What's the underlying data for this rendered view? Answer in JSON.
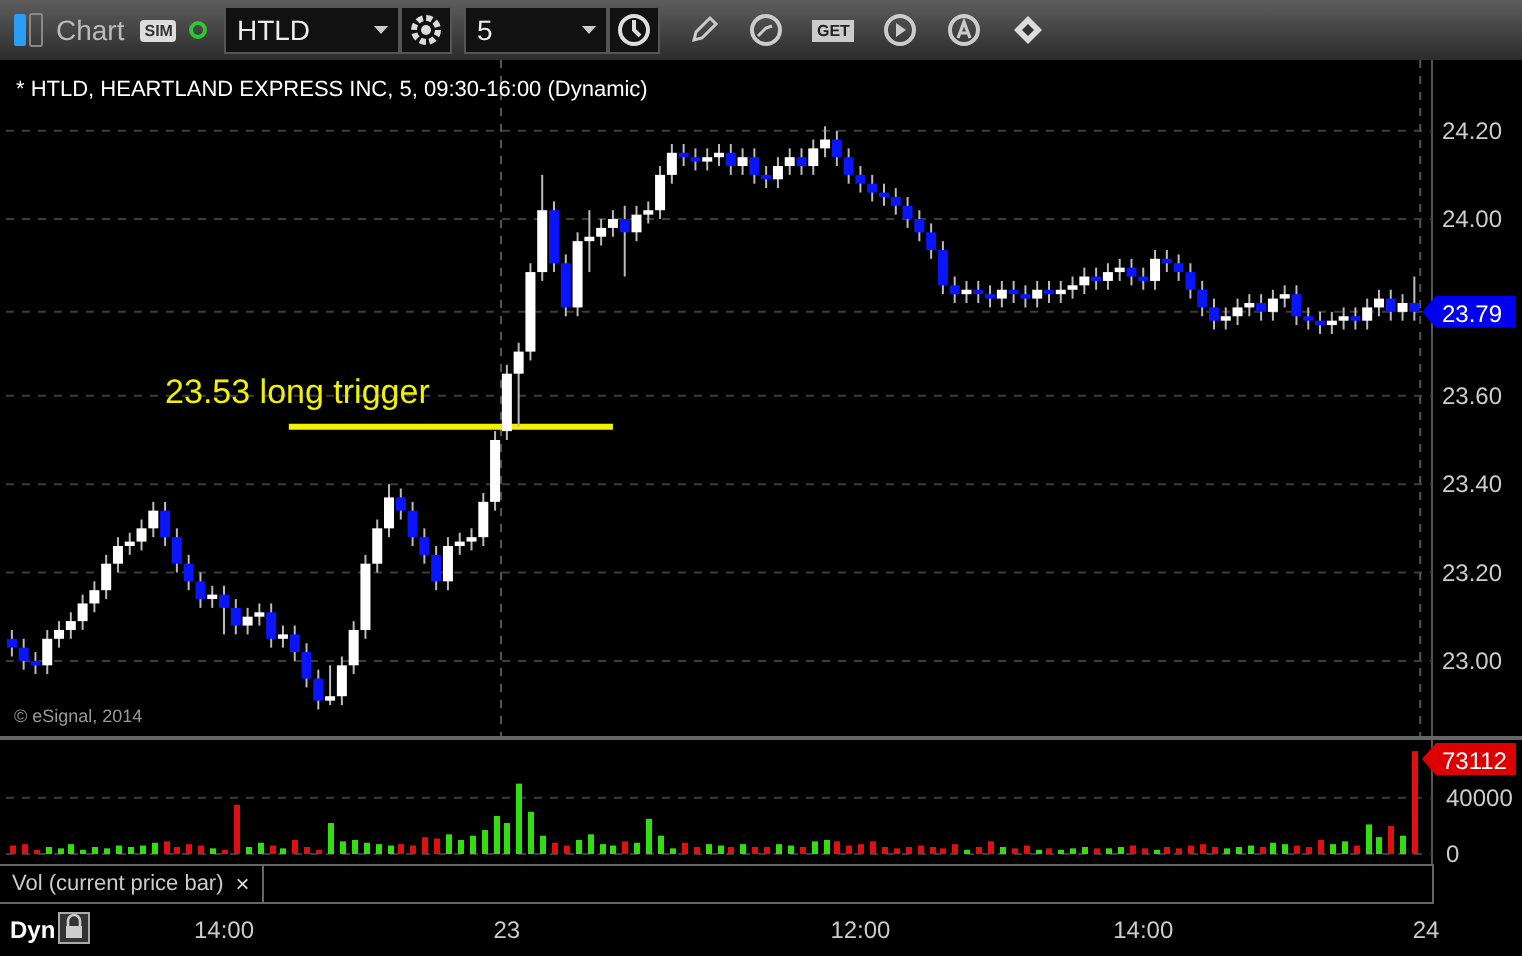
{
  "toolbar": {
    "title": "Chart",
    "badge": "SIM",
    "symbol": "HTLD",
    "interval": "5",
    "get_label": "GET"
  },
  "price_pane": {
    "chart_data": {
      "type": "candlestick",
      "title": "* HTLD, HEARTLAND EXPRESS INC, 5, 09:30-16:00 (Dynamic)",
      "ylim": [
        22.83,
        24.36
      ],
      "grid": true,
      "yticks": [
        {
          "value": 23.0,
          "label": "23.00"
        },
        {
          "value": 23.2,
          "label": "23.20"
        },
        {
          "value": 23.4,
          "label": "23.40"
        },
        {
          "value": 23.6,
          "label": "23.60"
        },
        {
          "value": 24.0,
          "label": "24.00"
        },
        {
          "value": 24.2,
          "label": "24.20"
        }
      ],
      "categories": [
        null,
        null,
        null,
        null,
        null,
        null,
        null,
        null,
        null,
        null,
        null,
        null,
        null,
        null,
        null,
        null,
        null,
        null,
        "14:00",
        null,
        null,
        null,
        null,
        null,
        null,
        null,
        null,
        null,
        null,
        null,
        null,
        null,
        null,
        null,
        null,
        null,
        null,
        null,
        null,
        null,
        null,
        null,
        "23",
        null,
        null,
        null,
        null,
        null,
        null,
        null,
        null,
        null,
        null,
        null,
        null,
        null,
        null,
        null,
        null,
        null,
        null,
        null,
        null,
        null,
        null,
        null,
        null,
        null,
        null,
        null,
        null,
        null,
        "12:00",
        null,
        null,
        null,
        null,
        null,
        null,
        null,
        null,
        null,
        null,
        null,
        null,
        null,
        null,
        null,
        null,
        null,
        null,
        null,
        null,
        null,
        null,
        null,
        "14:00",
        null,
        null,
        null,
        null,
        null,
        null,
        null,
        null,
        null,
        null,
        null,
        null,
        null,
        null,
        null,
        null,
        null,
        null,
        null,
        null,
        null,
        null,
        null,
        "24"
      ],
      "ohlc": [
        [
          23.05,
          23.07,
          23.01,
          23.03
        ],
        [
          23.03,
          23.05,
          22.98,
          23.0
        ],
        [
          23.0,
          23.02,
          22.97,
          22.99
        ],
        [
          22.99,
          23.07,
          22.97,
          23.05
        ],
        [
          23.05,
          23.09,
          23.03,
          23.07
        ],
        [
          23.07,
          23.11,
          23.05,
          23.09
        ],
        [
          23.09,
          23.15,
          23.07,
          23.13
        ],
        [
          23.13,
          23.18,
          23.11,
          23.16
        ],
        [
          23.16,
          23.24,
          23.14,
          23.22
        ],
        [
          23.22,
          23.28,
          23.2,
          23.26
        ],
        [
          23.26,
          23.29,
          23.24,
          23.27
        ],
        [
          23.27,
          23.32,
          23.25,
          23.3
        ],
        [
          23.3,
          23.36,
          23.28,
          23.34
        ],
        [
          23.34,
          23.36,
          23.26,
          23.28
        ],
        [
          23.28,
          23.3,
          23.2,
          23.22
        ],
        [
          23.22,
          23.24,
          23.16,
          23.18
        ],
        [
          23.18,
          23.2,
          23.12,
          23.14
        ],
        [
          23.14,
          23.17,
          23.12,
          23.15
        ],
        [
          23.15,
          23.17,
          23.06,
          23.12
        ],
        [
          23.12,
          23.14,
          23.06,
          23.08
        ],
        [
          23.08,
          23.12,
          23.06,
          23.1
        ],
        [
          23.1,
          23.13,
          23.08,
          23.11
        ],
        [
          23.11,
          23.13,
          23.03,
          23.05
        ],
        [
          23.05,
          23.08,
          23.03,
          23.06
        ],
        [
          23.06,
          23.08,
          23.0,
          23.02
        ],
        [
          23.02,
          23.04,
          22.94,
          22.96
        ],
        [
          22.96,
          22.98,
          22.89,
          22.91
        ],
        [
          22.91,
          22.99,
          22.9,
          22.92
        ],
        [
          22.92,
          23.01,
          22.9,
          22.99
        ],
        [
          22.99,
          23.09,
          22.97,
          23.07
        ],
        [
          23.07,
          23.24,
          23.05,
          23.22
        ],
        [
          23.22,
          23.32,
          23.2,
          23.3
        ],
        [
          23.3,
          23.4,
          23.28,
          23.37
        ],
        [
          23.37,
          23.39,
          23.32,
          23.34
        ],
        [
          23.34,
          23.36,
          23.26,
          23.28
        ],
        [
          23.28,
          23.3,
          23.22,
          23.24
        ],
        [
          23.24,
          23.26,
          23.16,
          23.18
        ],
        [
          23.18,
          23.28,
          23.16,
          23.26
        ],
        [
          23.26,
          23.29,
          23.24,
          23.27
        ],
        [
          23.27,
          23.3,
          23.25,
          23.28
        ],
        [
          23.28,
          23.38,
          23.26,
          23.36
        ],
        [
          23.36,
          23.52,
          23.34,
          23.5
        ],
        [
          23.52,
          23.67,
          23.5,
          23.65
        ],
        [
          23.65,
          23.72,
          23.53,
          23.7
        ],
        [
          23.7,
          23.9,
          23.68,
          23.88
        ],
        [
          23.88,
          24.1,
          23.86,
          24.02
        ],
        [
          24.02,
          24.04,
          23.88,
          23.9
        ],
        [
          23.9,
          23.92,
          23.78,
          23.8
        ],
        [
          23.8,
          23.97,
          23.78,
          23.95
        ],
        [
          23.95,
          24.02,
          23.88,
          23.96
        ],
        [
          23.96,
          24.0,
          23.94,
          23.98
        ],
        [
          23.98,
          24.02,
          23.96,
          24.0
        ],
        [
          24.0,
          24.03,
          23.87,
          23.97
        ],
        [
          23.97,
          24.03,
          23.95,
          24.01
        ],
        [
          24.01,
          24.04,
          23.99,
          24.02
        ],
        [
          24.02,
          24.12,
          24.0,
          24.1
        ],
        [
          24.1,
          24.17,
          24.08,
          24.15
        ],
        [
          24.15,
          24.17,
          24.12,
          24.14
        ],
        [
          24.14,
          24.16,
          24.11,
          24.13
        ],
        [
          24.13,
          24.16,
          24.11,
          24.14
        ],
        [
          24.14,
          24.17,
          24.12,
          24.15
        ],
        [
          24.15,
          24.17,
          24.1,
          24.12
        ],
        [
          24.12,
          24.16,
          24.1,
          24.14
        ],
        [
          24.14,
          24.16,
          24.08,
          24.1
        ],
        [
          24.1,
          24.12,
          24.07,
          24.09
        ],
        [
          24.09,
          24.14,
          24.07,
          24.12
        ],
        [
          24.12,
          24.16,
          24.1,
          24.14
        ],
        [
          24.14,
          24.16,
          24.1,
          24.12
        ],
        [
          24.12,
          24.18,
          24.1,
          24.16
        ],
        [
          24.16,
          24.21,
          24.14,
          24.18
        ],
        [
          24.18,
          24.2,
          24.12,
          24.14
        ],
        [
          24.14,
          24.16,
          24.08,
          24.1
        ],
        [
          24.1,
          24.12,
          24.06,
          24.08
        ],
        [
          24.08,
          24.1,
          24.04,
          24.06
        ],
        [
          24.06,
          24.08,
          24.03,
          24.05
        ],
        [
          24.05,
          24.07,
          24.01,
          24.03
        ],
        [
          24.03,
          24.05,
          23.98,
          24.0
        ],
        [
          24.0,
          24.02,
          23.95,
          23.97
        ],
        [
          23.97,
          23.99,
          23.91,
          23.93
        ],
        [
          23.93,
          23.95,
          23.83,
          23.85
        ],
        [
          23.85,
          23.87,
          23.81,
          23.83
        ],
        [
          23.83,
          23.86,
          23.81,
          23.84
        ],
        [
          23.84,
          23.86,
          23.81,
          23.83
        ],
        [
          23.83,
          23.85,
          23.8,
          23.82
        ],
        [
          23.82,
          23.86,
          23.8,
          23.84
        ],
        [
          23.84,
          23.86,
          23.81,
          23.83
        ],
        [
          23.83,
          23.85,
          23.8,
          23.82
        ],
        [
          23.82,
          23.86,
          23.8,
          23.84
        ],
        [
          23.84,
          23.86,
          23.81,
          23.83
        ],
        [
          23.83,
          23.86,
          23.81,
          23.84
        ],
        [
          23.84,
          23.87,
          23.82,
          23.85
        ],
        [
          23.85,
          23.89,
          23.83,
          23.87
        ],
        [
          23.87,
          23.89,
          23.84,
          23.86
        ],
        [
          23.86,
          23.9,
          23.84,
          23.88
        ],
        [
          23.88,
          23.91,
          23.86,
          23.89
        ],
        [
          23.89,
          23.91,
          23.85,
          23.87
        ],
        [
          23.87,
          23.89,
          23.84,
          23.86
        ],
        [
          23.86,
          23.93,
          23.84,
          23.91
        ],
        [
          23.91,
          23.93,
          23.88,
          23.9
        ],
        [
          23.9,
          23.92,
          23.86,
          23.88
        ],
        [
          23.88,
          23.9,
          23.82,
          23.84
        ],
        [
          23.84,
          23.86,
          23.78,
          23.8
        ],
        [
          23.8,
          23.82,
          23.75,
          23.77
        ],
        [
          23.77,
          23.8,
          23.75,
          23.78
        ],
        [
          23.78,
          23.82,
          23.76,
          23.8
        ],
        [
          23.8,
          23.83,
          23.78,
          23.81
        ],
        [
          23.81,
          23.83,
          23.77,
          23.79
        ],
        [
          23.79,
          23.84,
          23.77,
          23.82
        ],
        [
          23.82,
          23.85,
          23.8,
          23.83
        ],
        [
          23.83,
          23.85,
          23.76,
          23.78
        ],
        [
          23.78,
          23.8,
          23.75,
          23.77
        ],
        [
          23.77,
          23.79,
          23.74,
          23.76
        ],
        [
          23.76,
          23.79,
          23.74,
          23.77
        ],
        [
          23.77,
          23.8,
          23.75,
          23.78
        ],
        [
          23.78,
          23.8,
          23.75,
          23.77
        ],
        [
          23.77,
          23.82,
          23.75,
          23.8
        ],
        [
          23.8,
          23.84,
          23.78,
          23.82
        ],
        [
          23.82,
          23.84,
          23.77,
          23.79
        ],
        [
          23.79,
          23.83,
          23.77,
          23.81
        ],
        [
          23.81,
          23.87,
          23.77,
          23.79
        ],
        null
      ],
      "ref_lines": [
        {
          "axis": "y",
          "value": 23.53
        }
      ],
      "annotations": [
        "23.53 long trigger"
      ]
    },
    "last_price_label": "23.79",
    "credit": "© eSignal, 2014"
  },
  "volume_pane": {
    "chart_data": {
      "type": "bar",
      "ylim": [
        0,
        81000
      ],
      "grid": true,
      "yticks": [
        {
          "value": 0,
          "label": "0"
        },
        {
          "value": 40000,
          "label": "40000"
        }
      ],
      "values": [
        6000,
        7000,
        3000,
        5000,
        4000,
        7000,
        3000,
        5000,
        4000,
        6000,
        5000,
        6000,
        8000,
        9000,
        5000,
        7000,
        6000,
        4000,
        3000,
        35000,
        5000,
        8000,
        6000,
        4000,
        10000,
        5000,
        3000,
        22000,
        9000,
        10000,
        8000,
        7000,
        6000,
        7000,
        6000,
        12000,
        11000,
        14000,
        10000,
        13000,
        17000,
        27000,
        22000,
        50000,
        30000,
        13000,
        8000,
        6000,
        10000,
        14000,
        7000,
        6000,
        9000,
        8000,
        25000,
        13000,
        4000,
        8000,
        5000,
        7000,
        6000,
        5000,
        7000,
        5000,
        5000,
        7000,
        6000,
        5000,
        9000,
        10000,
        9000,
        6000,
        7000,
        9000,
        5000,
        4000,
        5000,
        6000,
        5000,
        4000,
        7000,
        3000,
        5000,
        9000,
        5000,
        4000,
        6000,
        3000,
        4000,
        3000,
        4000,
        5000,
        4000,
        4000,
        5000,
        6000,
        4000,
        3000,
        5000,
        4000,
        6000,
        7000,
        5000,
        4000,
        5000,
        6000,
        5000,
        8000,
        7000,
        6000,
        5000,
        10000,
        7000,
        9000,
        6000,
        21000,
        12000,
        20000,
        13000,
        73112,
        null
      ]
    },
    "last_value_label": "73112",
    "study_label": "Vol (current price bar)",
    "close_glyph": "×"
  },
  "time_axis": {
    "mode_label": "Dyn"
  }
}
